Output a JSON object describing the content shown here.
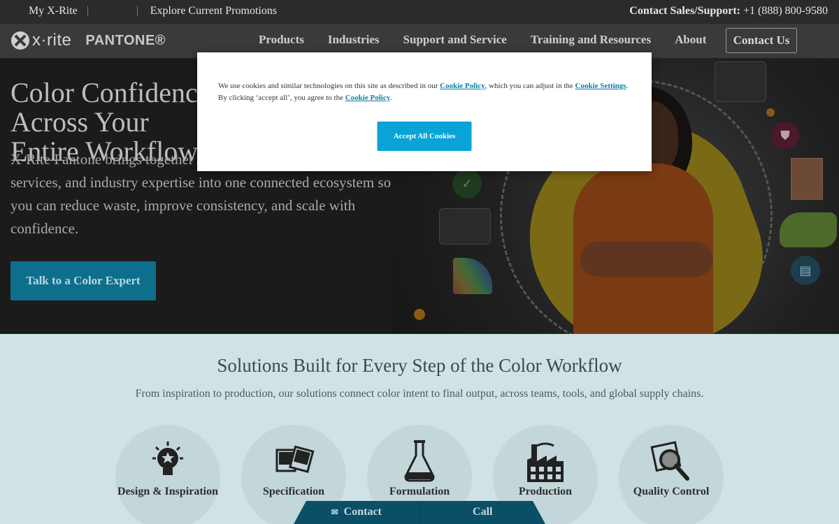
{
  "topbar": {
    "my_xrite": "My X-Rite",
    "promotions": "Explore Current Promotions",
    "contact_label": "Contact Sales/Support:",
    "contact_phone": "+1 (888) 800-9580"
  },
  "logo": {
    "xrite": "x·rite",
    "pantone": "PANTONE®"
  },
  "nav": {
    "items": [
      "Products",
      "Industries",
      "Support and Service",
      "Training and Resources",
      "About"
    ],
    "contact_button": "Contact Us"
  },
  "hero": {
    "title": "Color Confidence Across Your Entire Workflow",
    "body": "X-Rite Pantone brings together color measurement, software, services, and industry expertise into one connected ecosystem so you can reduce waste, improve consistency, and scale with confidence.",
    "cta": "Talk to a Color Expert"
  },
  "solutions": {
    "heading": "Solutions Built for Every Step of the Color Workflow",
    "subheading": "From inspiration to production, our solutions connect color intent to final output, across teams, tools, and global supply chains.",
    "cards": [
      {
        "label": "Design & Inspiration",
        "icon": "lightbulb-star-icon"
      },
      {
        "label": "Specification",
        "icon": "swatch-cards-icon"
      },
      {
        "label": "Formulation",
        "icon": "flask-icon"
      },
      {
        "label": "Production",
        "icon": "factory-icon"
      },
      {
        "label": "Quality Control",
        "icon": "magnifier-icon"
      }
    ]
  },
  "bottom_tab": {
    "contact": "Contact",
    "call": "Call"
  },
  "cookie": {
    "text_1": "We use cookies and similar technologies on this site as described in our ",
    "link_1": "Cookie Policy",
    "text_2": ", which you can adjust in the ",
    "link_2": "Cookie Settings",
    "text_3": ". By clicking ‘accept all’, you agree to the ",
    "link_3": "Cookie Policy",
    "text_4": ".",
    "accept": "Accept All Cookies"
  },
  "colors": {
    "brand_teal": "#0aa3d8",
    "cta_blue": "#0d6f8c",
    "section_bg": "#cfe2e6"
  }
}
